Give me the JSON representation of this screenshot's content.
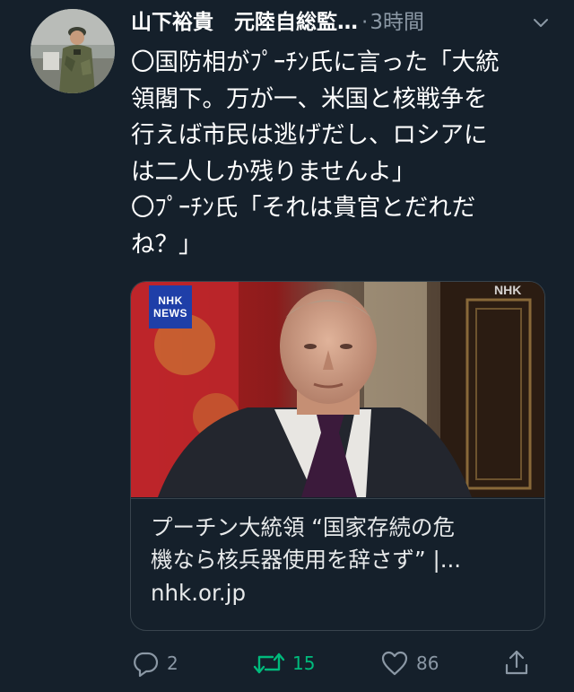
{
  "tweet": {
    "display_name": "山下裕貴　元陸自総監…",
    "separator": "·",
    "time": "3時間",
    "body": "〇国防相がﾌﾟｰﾁﾝ氏に言った「大統\n領閣下。万が一、米国と核戦争を\n行えば市民は逃げだし、ロシアに\nは二人しか残りませんよ」\n〇ﾌﾟｰﾁﾝ氏「それは貴官とだれだ\nね？」"
  },
  "card": {
    "logo_line1": "NHK",
    "logo_line2": "NEWS",
    "title": "プーチン大統領 “国家存続の危\n機なら核兵器使用を辞さず” |...",
    "domain": "nhk.or.jp"
  },
  "actions": {
    "reply_count": "2",
    "retweet_count": "15",
    "like_count": "86"
  },
  "icons": {
    "more": "chevron-down-icon",
    "reply": "reply-icon",
    "retweet": "retweet-icon",
    "like": "heart-icon",
    "share": "share-icon"
  },
  "colors": {
    "background": "#15202b",
    "secondary_text": "#8b98a5",
    "retweet_active": "#00ba7c",
    "card_border": "#38444d"
  }
}
